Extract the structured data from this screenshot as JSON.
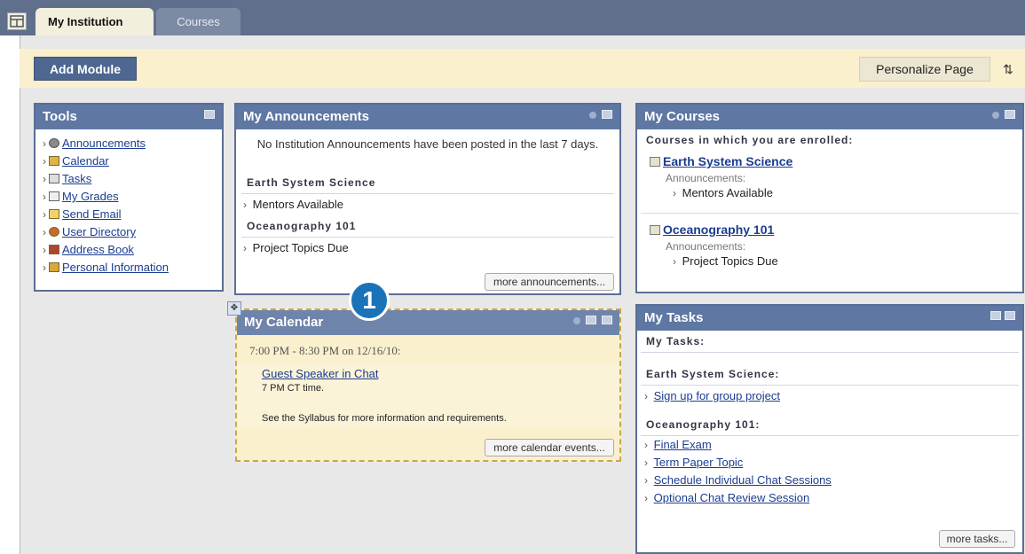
{
  "tabs": [
    {
      "label": "My Institution"
    },
    {
      "label": "Courses"
    }
  ],
  "toolbar": {
    "add_module": "Add Module",
    "personalize": "Personalize Page",
    "reorder_icon": "reorder-arrows-icon"
  },
  "tools": {
    "title": "Tools",
    "items": [
      {
        "label": "Announcements",
        "icon": "announcements-icon"
      },
      {
        "label": "Calendar",
        "icon": "calendar-icon"
      },
      {
        "label": "Tasks",
        "icon": "tasks-icon"
      },
      {
        "label": "My Grades",
        "icon": "grades-icon"
      },
      {
        "label": "Send Email",
        "icon": "email-icon"
      },
      {
        "label": "User Directory",
        "icon": "user-directory-icon"
      },
      {
        "label": "Address Book",
        "icon": "address-book-icon"
      },
      {
        "label": "Personal Information",
        "icon": "personal-info-icon"
      }
    ]
  },
  "announcements": {
    "title": "My Announcements",
    "message": "No Institution Announcements have been posted in the last 7 days.",
    "groups": [
      {
        "course": "Earth System Science",
        "item": "Mentors Available"
      },
      {
        "course": "Oceanography 101",
        "item": "Project Topics Due"
      }
    ],
    "more": "more announcements..."
  },
  "calendar": {
    "title": "My Calendar",
    "time": "7:00 PM - 8:30 PM on 12/16/10:",
    "event_title": "Guest Speaker in Chat",
    "event_line1": "7 PM CT time.",
    "event_line2": "See the Syllabus for more information and requirements.",
    "more": "more calendar events..."
  },
  "courses": {
    "title": "My Courses",
    "subtitle": "Courses in which you are enrolled:",
    "list": [
      {
        "name": "Earth System Science",
        "ann_label": "Announcements:",
        "ann_item": "Mentors Available"
      },
      {
        "name": "Oceanography 101",
        "ann_label": "Announcements:",
        "ann_item": "Project Topics Due"
      }
    ]
  },
  "tasks": {
    "title": "My Tasks",
    "header": "My Tasks:",
    "group1": "Earth System Science:",
    "group1_items": [
      "Sign up for group project"
    ],
    "group2": "Oceanography 101:",
    "group2_items": [
      "Final Exam",
      "Term Paper Topic",
      "Schedule Individual Chat Sessions",
      "Optional Chat Review Session"
    ],
    "more": "more tasks..."
  },
  "callout": {
    "number": "1"
  },
  "colors": {
    "module_header": "#5e77a3",
    "toolbar_bg": "#fbf0cd",
    "callout": "#1a73b8"
  }
}
